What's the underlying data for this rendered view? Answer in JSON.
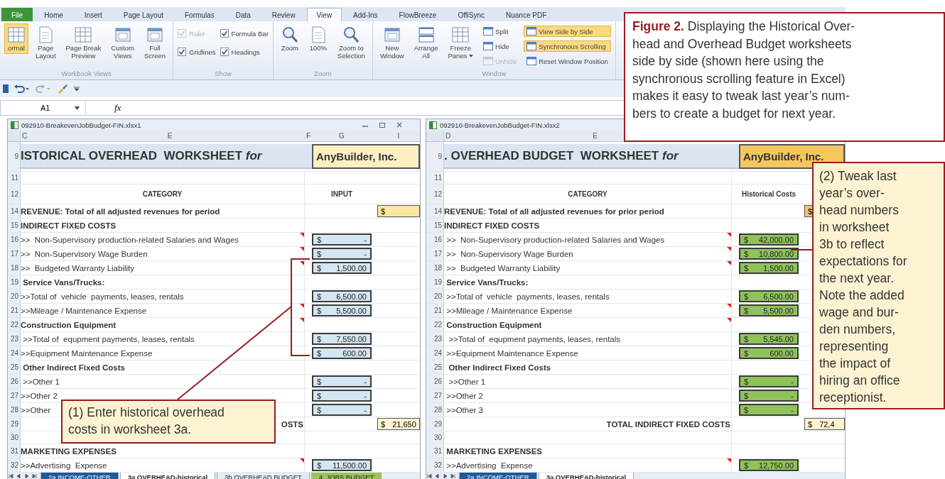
{
  "ribbon": {
    "tabs": [
      {
        "label": "File",
        "kind": "file",
        "selected": false
      },
      {
        "label": "Home",
        "kind": "tab",
        "selected": false
      },
      {
        "label": "Insert",
        "kind": "tab",
        "selected": false
      },
      {
        "label": "Page Layout",
        "kind": "tab",
        "selected": false
      },
      {
        "label": "Formulas",
        "kind": "tab",
        "selected": false
      },
      {
        "label": "Data",
        "kind": "tab",
        "selected": false
      },
      {
        "label": "Review",
        "kind": "tab",
        "selected": false
      },
      {
        "label": "View",
        "kind": "tab",
        "selected": true
      },
      {
        "label": "Add-Ins",
        "kind": "tab",
        "selected": false
      },
      {
        "label": "FlowBreeze",
        "kind": "tab",
        "selected": false
      },
      {
        "label": "OffiSync",
        "kind": "tab",
        "selected": false
      },
      {
        "label": "Nuance PDF",
        "kind": "tab",
        "selected": false
      }
    ],
    "groups": [
      {
        "label": "Workbook Views",
        "items": [
          {
            "kind": "large",
            "lines": [
              "ormal"
            ],
            "selected": true,
            "disabled": false
          },
          {
            "kind": "large",
            "lines": [
              "Page",
              "Layout"
            ],
            "selected": false,
            "disabled": false
          },
          {
            "kind": "large",
            "lines": [
              "Page Break",
              "Preview"
            ],
            "selected": false,
            "disabled": false
          },
          {
            "kind": "large",
            "lines": [
              "Custom",
              "Views"
            ],
            "selected": false,
            "disabled": false
          },
          {
            "kind": "large",
            "lines": [
              "Full",
              "Screen"
            ],
            "selected": false,
            "disabled": false
          }
        ]
      },
      {
        "label": "Show",
        "items": [
          {
            "kind": "check",
            "lines": [
              "Ruler"
            ],
            "checked": true,
            "disabled": true
          },
          {
            "kind": "check",
            "lines": [
              "Gridlines"
            ],
            "checked": true,
            "disabled": false
          },
          {
            "kind": "check",
            "lines": [
              "Formula Bar"
            ],
            "checked": true,
            "disabled": false
          },
          {
            "kind": "check",
            "lines": [
              "Headings"
            ],
            "checked": true,
            "disabled": false
          }
        ]
      },
      {
        "label": "Zoom",
        "items": [
          {
            "kind": "large",
            "lines": [
              "Zoom"
            ],
            "selected": false,
            "disabled": false
          },
          {
            "kind": "large",
            "lines": [
              "100%"
            ],
            "selected": false,
            "disabled": false
          },
          {
            "kind": "large",
            "lines": [
              "Zoom to",
              "Selection"
            ],
            "selected": false,
            "disabled": false
          }
        ]
      },
      {
        "label": "Window",
        "items": [
          {
            "kind": "large",
            "lines": [
              "New",
              "Window"
            ],
            "selected": false,
            "disabled": false
          },
          {
            "kind": "large",
            "lines": [
              "Arrange",
              "All"
            ],
            "selected": false,
            "disabled": false
          },
          {
            "kind": "dropdown",
            "lines": [
              "Freeze",
              "Panes"
            ],
            "selected": false,
            "disabled": false
          },
          {
            "kind": "small",
            "lines": [
              "Split"
            ],
            "selected": false,
            "disabled": false
          },
          {
            "kind": "small",
            "lines": [
              "Hide"
            ],
            "selected": false,
            "disabled": false
          },
          {
            "kind": "small",
            "lines": [
              "Unhide"
            ],
            "selected": false,
            "disabled": true
          },
          {
            "kind": "small",
            "lines": [
              "View Side by Side"
            ],
            "selected": true,
            "disabled": false
          },
          {
            "kind": "small",
            "lines": [
              "Synchronous Scrolling"
            ],
            "selected": true,
            "disabled": false
          },
          {
            "kind": "small",
            "lines": [
              "Reset Window Position"
            ],
            "selected": false,
            "disabled": false
          }
        ]
      }
    ]
  },
  "formula_bar": {
    "name_box": "A1",
    "fx": "fx"
  },
  "panes": [
    {
      "kind": "historical",
      "title": "092910-BreakevenJobBudget-FIN.xlsx1",
      "window_controls": true,
      "column_headers": [
        "C",
        "E",
        "F",
        "G",
        "I"
      ],
      "rows": [
        {
          "num": "9",
          "kind": "title",
          "heading": "ISTORICAL OVERHEAD  WORKSHEET *for*",
          "company": "AnyBuilder, Inc."
        },
        {
          "num": "11",
          "kind": "blank",
          "comment": false
        },
        {
          "num": "12",
          "kind": "header",
          "label": "CATEGORY",
          "value": "INPUT",
          "comment": false
        },
        {
          "num": "14",
          "kind": "revenue",
          "label": "REVENUE: Total of all adjusted revenues for period",
          "extra": {
            "currency": "$"
          },
          "comment": false
        },
        {
          "num": "15",
          "kind": "section",
          "label": "INDIRECT FIXED COSTS",
          "comment": false
        },
        {
          "num": "16",
          "kind": "item",
          "label": ">>  Non-Supervisory production-related Salaries and Wages",
          "currency": "$",
          "amount": "-",
          "comment": true
        },
        {
          "num": "17",
          "kind": "item",
          "label": ">>  Non-Supervisory Wage Burden",
          "currency": "$",
          "amount": "-",
          "comment": true
        },
        {
          "num": "18",
          "kind": "item",
          "label": ">>  Budgeted Warranty Liability",
          "currency": "$",
          "amount": "1,500.00",
          "comment": true
        },
        {
          "num": "19",
          "kind": "section",
          "label": " Service Vans/Trucks:",
          "comment": false
        },
        {
          "num": "20",
          "kind": "item",
          "label": ">>Total of  vehicle  payments, leases, rentals",
          "currency": "$",
          "amount": "6,500.00",
          "comment": false
        },
        {
          "num": "21",
          "kind": "item",
          "label": ">>Mileage / Maintenance Expense",
          "currency": "$",
          "amount": "5,500.00",
          "comment": true
        },
        {
          "num": "22",
          "kind": "section",
          "label": "Construction Equipment",
          "comment": true
        },
        {
          "num": "23",
          "kind": "item",
          "label": " >>Total of  equpment payments, leases, rentals",
          "currency": "$",
          "amount": "7,550.00",
          "comment": false
        },
        {
          "num": "24",
          "kind": "item",
          "label": ">>Equipment Maintenance Expense",
          "currency": "$",
          "amount": "600.00",
          "comment": false
        },
        {
          "num": "25",
          "kind": "section",
          "label": " Other Indirect Fixed Costs",
          "comment": false
        },
        {
          "num": "26",
          "kind": "item",
          "label": " >>Other 1",
          "currency": "$",
          "amount": "-",
          "comment": false
        },
        {
          "num": "27",
          "kind": "item",
          "label": ">>Other 2",
          "currency": "$",
          "amount": "-",
          "comment": false
        },
        {
          "num": "28",
          "kind": "item",
          "label": ">>Other",
          "currency": "$",
          "amount": "-",
          "comment": false
        },
        {
          "num": "29",
          "kind": "total",
          "label": "OSTS",
          "extra": {
            "currency": "$",
            "amount": "21,650"
          },
          "comment": false
        },
        {
          "num": "30",
          "kind": "blank",
          "comment": false
        },
        {
          "num": "31",
          "kind": "section",
          "label": "MARKETING EXPENSES",
          "comment": false
        },
        {
          "num": "32",
          "kind": "item",
          "label": ">>Advertising  Expense",
          "currency": "$",
          "amount": "11,500.00",
          "comment": true
        }
      ],
      "sheet_tabs": [
        {
          "label": "2a.INCOME-OTHER",
          "selected": false,
          "color": "#1f5a9a"
        },
        {
          "label": "3a.OVERHEAD-historical",
          "selected": true,
          "color": "#ffffff"
        },
        {
          "label": "3b.OVERHEAD BUDGET",
          "selected": false,
          "color": "#e4ebf3"
        },
        {
          "label": "4. JOBS BUDGET",
          "selected": false,
          "color": "#9bc45c"
        }
      ]
    },
    {
      "kind": "budget",
      "title": "092910-BreakevenJobBudget-FIN.xlsx2",
      "window_controls": false,
      "column_headers": [
        "D",
        "E"
      ],
      "rows": [
        {
          "num": "9",
          "kind": "title",
          "heading": ". OVERHEAD BUDGET  WORKSHEET *for*",
          "company": "AnyBuilder, Inc."
        },
        {
          "num": "11",
          "kind": "blank",
          "comment": false
        },
        {
          "num": "12",
          "kind": "header",
          "label": "CATEGORY",
          "value": "Historical Costs",
          "comment": false
        },
        {
          "num": "14",
          "kind": "revenue",
          "label": "REVENUE: Total of all adjusted revenues for prior period",
          "extra": {
            "currency": "$"
          },
          "comment": false
        },
        {
          "num": "15",
          "kind": "section",
          "label": "INDIRECT FIXED COSTS",
          "comment": false
        },
        {
          "num": "16",
          "kind": "item",
          "label": " >>  Non-Supervisory production-related Salaries and Wages",
          "currency": "$",
          "amount": "42,000.00",
          "comment": true
        },
        {
          "num": "17",
          "kind": "item",
          "label": " >>  Non-Supervisory Wage Burden",
          "currency": "$",
          "amount": "10,800.00",
          "comment": true
        },
        {
          "num": "18",
          "kind": "item",
          "label": " >>  Budgeted Warranty Liability",
          "currency": "$",
          "amount": "1,500.00",
          "comment": true
        },
        {
          "num": "19",
          "kind": "section",
          "label": " Service Vans/Trucks:",
          "comment": false
        },
        {
          "num": "20",
          "kind": "item",
          "label": " >>Total of  vehicle  payments, leases, rentals",
          "currency": "$",
          "amount": "6,500.00",
          "comment": false
        },
        {
          "num": "21",
          "kind": "item",
          "label": " >>Mileage / Maintenance Expense",
          "currency": "$",
          "amount": "5,500.00",
          "comment": true
        },
        {
          "num": "22",
          "kind": "section",
          "label": " Construction Equipment",
          "comment": true
        },
        {
          "num": "23",
          "kind": "item",
          "label": "  >>Total of  equpment payments, leases, rentals",
          "currency": "$",
          "amount": "5,545.00",
          "comment": false
        },
        {
          "num": "24",
          "kind": "item",
          "label": " >>Equipment Maintenance Expense",
          "currency": "$",
          "amount": "600.00",
          "comment": false
        },
        {
          "num": "25",
          "kind": "section",
          "label": "  Other Indirect Fixed Costs",
          "comment": false
        },
        {
          "num": "26",
          "kind": "item",
          "label": "  >>Other 1",
          "currency": "$",
          "amount": "-",
          "comment": false
        },
        {
          "num": "27",
          "kind": "item",
          "label": " >>Other 2",
          "currency": "$",
          "amount": "-",
          "comment": false
        },
        {
          "num": "28",
          "kind": "item",
          "label": " >>Other 3",
          "currency": "$",
          "amount": "-",
          "comment": false
        },
        {
          "num": "29",
          "kind": "total",
          "label": "TOTAL INDIRECT FIXED COSTS",
          "extra": {
            "currency": "$",
            "amount": "72,4"
          },
          "comment": false
        },
        {
          "num": "30",
          "kind": "blank",
          "comment": false
        },
        {
          "num": "31",
          "kind": "section",
          "label": " MARKETING EXPENSES",
          "comment": false
        },
        {
          "num": "32",
          "kind": "item",
          "label": " >>Advertising  Expense",
          "currency": "$",
          "amount": "12,750.00",
          "comment": true
        }
      ],
      "sheet_tabs": [
        {
          "label": "2a.INCOME-OTHER",
          "selected": false,
          "color": "#1f5a9a"
        },
        {
          "label": "3a.OVERHEAD-historical",
          "selected": true,
          "color": "#ffffff"
        }
      ]
    }
  ],
  "caption": "**Figure 2.** Displaying the Historical Over-\nhead and Overhead Budget worksheets\nside by side (shown here using the\nsynchronous scrolling feature in Excel)\nmakes it easy to tweak last year’s num-\nbers to create a budget for next year.",
  "callouts": [
    {
      "kind": "left",
      "text": "(1) Enter historical overhead\ncosts in worksheet 3a."
    },
    {
      "kind": "right",
      "text": "(2) Tweak last\nyear’s over-\nhead numbers\nin worksheet\n3b to reflect\nexpectations for\nthe next year.\nNote the added\nwage and bur-\nden numbers,\nrepresenting\nthe impact of\nhiring an office\nreceptionist."
    }
  ]
}
